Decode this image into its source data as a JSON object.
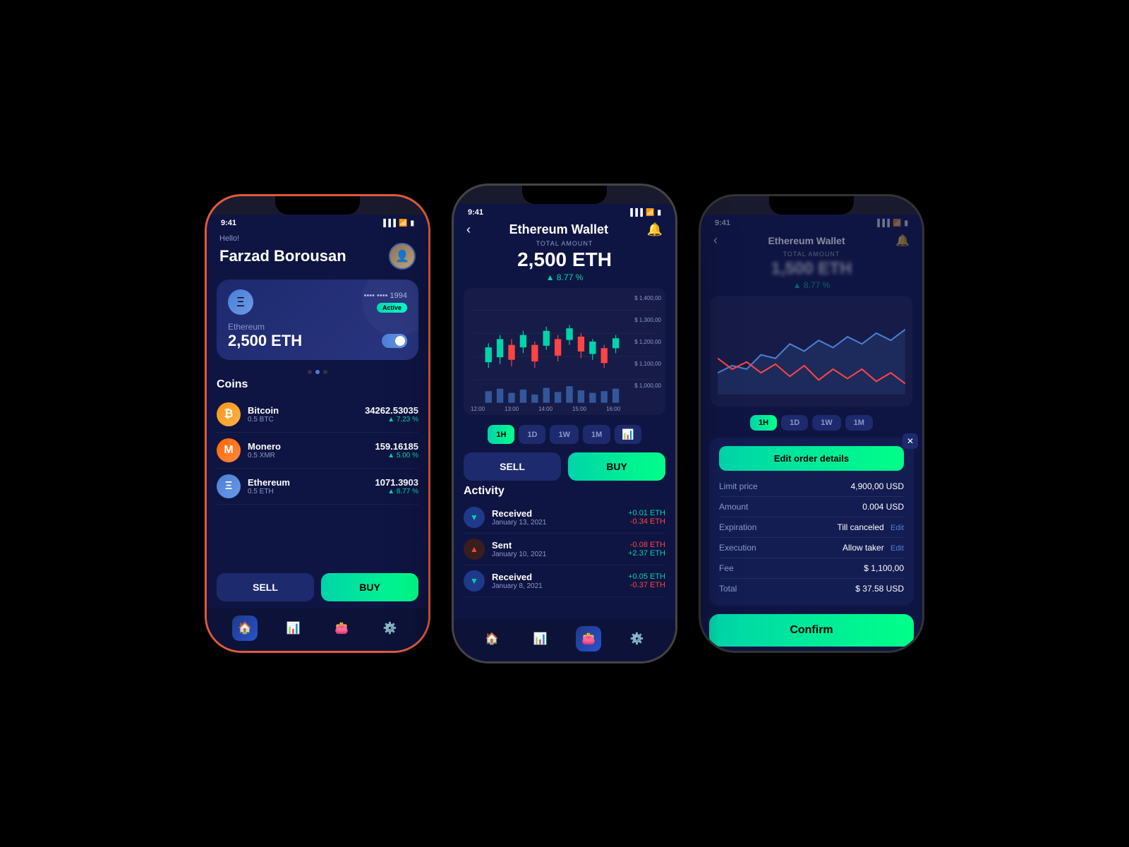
{
  "phone1": {
    "statusTime": "9:41",
    "greeting": "Hello!",
    "userName": "Farzad Borousan",
    "card": {
      "cardNums": "•••• •••• 1994",
      "activeBadge": "Active",
      "coinLabel": "Ethereum",
      "amount": "2,500 ETH"
    },
    "coinsTitle": "Coins",
    "coins": [
      {
        "name": "Bitcoin",
        "sub": "0.5 BTC",
        "amount": "34262.53035",
        "change": "▲ 7.23 %",
        "iconType": "btc"
      },
      {
        "name": "Monero",
        "sub": "0.5 XMR",
        "amount": "159.16185",
        "change": "▲ 5.00 %",
        "iconType": "xmr"
      },
      {
        "name": "Ethereum",
        "sub": "0.5 ETH",
        "amount": "1071.3903",
        "change": "▲ 8.77 %",
        "iconType": "eth"
      }
    ],
    "sellBtn": "SELL",
    "buyBtn": "BUY"
  },
  "phone2": {
    "statusTime": "9:41",
    "backBtn": "‹",
    "title": "Ethereum Wallet",
    "totalLabel": "TOTAL AMOUNT",
    "totalAmount": "2,500 ETH",
    "change": "▲ 8.77 %",
    "chartLabelsY": [
      "$ 1,400,00",
      "$ 1,300,00",
      "$ 1,200,00",
      "$ 1,100,00",
      "$ 1,000,00"
    ],
    "chartLabelsX": [
      "12:00",
      "13:00",
      "14:00",
      "15:00",
      "16:00"
    ],
    "timeFilters": [
      {
        "label": "1H",
        "active": true
      },
      {
        "label": "1D",
        "active": false
      },
      {
        "label": "1W",
        "active": false
      },
      {
        "label": "1M",
        "active": false
      },
      {
        "label": "📊",
        "active": false,
        "isChart": true
      }
    ],
    "sellBtn": "SELL",
    "buyBtn": "BUY",
    "activityTitle": "Activity",
    "activities": [
      {
        "type": "Received",
        "date": "January 13, 2021",
        "pos": "+0.01 ETH",
        "neg": "-0.34 ETH",
        "iconType": "received"
      },
      {
        "type": "Sent",
        "date": "January 10, 2021",
        "pos": "-0.08 ETH",
        "neg": "+2.37 ETH",
        "iconType": "sent"
      },
      {
        "type": "Received",
        "date": "January 8, 2021",
        "pos": "+0.05 ETH",
        "neg": "-0.37 ETH",
        "iconType": "received"
      }
    ]
  },
  "phone3": {
    "statusTime": "9:41",
    "title": "Ethereum Wallet",
    "totalLabel": "TOTAL AMOUNT",
    "totalAmount": "1,500 ETH",
    "change": "▲ 8.77 %",
    "timeFilters": [
      {
        "label": "1H",
        "active": true
      },
      {
        "label": "1D",
        "active": false
      },
      {
        "label": "1W",
        "active": false
      },
      {
        "label": "1M",
        "active": false
      }
    ],
    "editOrderBtn": "Edit order details",
    "order": {
      "rows": [
        {
          "label": "Limit price",
          "value": "4,900,00 USD",
          "editable": false
        },
        {
          "label": "Amount",
          "value": "0.004 USD",
          "editable": false
        },
        {
          "label": "Expiration",
          "value": "Till canceled",
          "editable": true
        },
        {
          "label": "Execution",
          "value": "Allow taker",
          "editable": true
        },
        {
          "label": "Fee",
          "value": "$ 1,100,00",
          "editable": false
        },
        {
          "label": "Total",
          "value": "$ 37.58 USD",
          "editable": false
        }
      ]
    },
    "editLabel": "Edit",
    "confirmBtn": "Confirm"
  }
}
